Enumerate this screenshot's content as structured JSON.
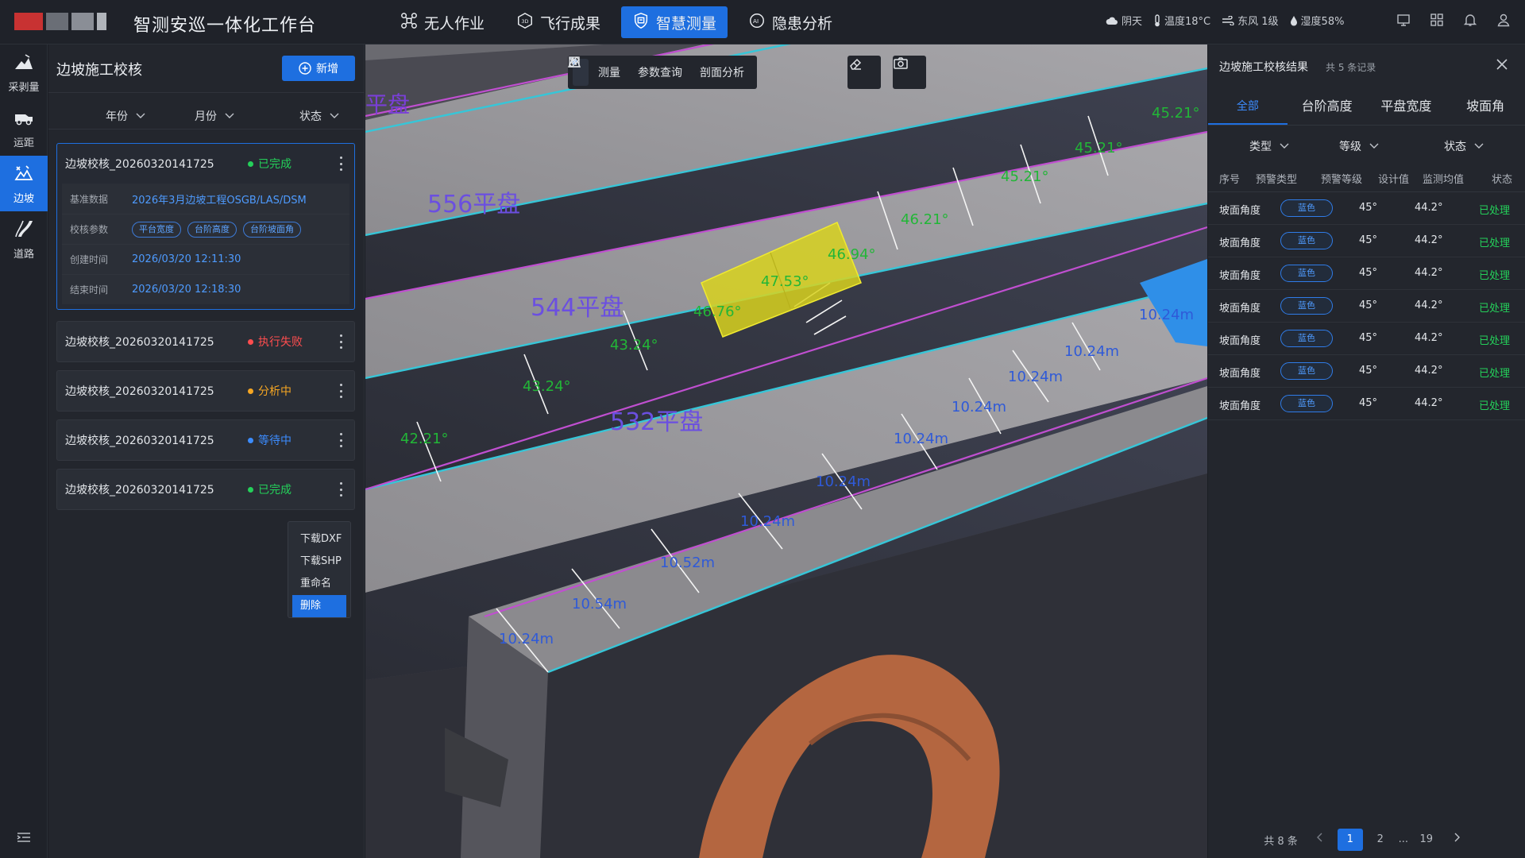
{
  "header": {
    "title": "智测安巡一体化工作台",
    "nav": [
      {
        "label": "无人作业",
        "icon": "drone-icon"
      },
      {
        "label": "飞行成果",
        "icon": "3d-icon"
      },
      {
        "label": "智慧测量",
        "icon": "survey-icon",
        "active": true
      },
      {
        "label": "隐患分析",
        "icon": "ai-icon"
      }
    ],
    "weather": {
      "condition": "阴天",
      "temperature": "温度18°C",
      "wind": "东风 1级",
      "humidity": "湿度58%"
    }
  },
  "rail": {
    "items": [
      {
        "label": "采剥量",
        "icon": "mining-icon"
      },
      {
        "label": "运距",
        "icon": "truck-icon"
      },
      {
        "label": "边坡",
        "icon": "slope-icon",
        "active": true
      },
      {
        "label": "道路",
        "icon": "road-icon"
      }
    ]
  },
  "left_panel": {
    "title": "边坡施工校核",
    "add_label": "新增",
    "filters": {
      "year": "年份",
      "month": "月份",
      "status": "状态"
    },
    "cards": [
      {
        "name": "边坡校核_20260320141725",
        "status": "已完成",
        "status_color": "#24d05a",
        "expanded": true,
        "details": {
          "base_label": "基准数据",
          "base_value": "2026年3月边坡工程OSGB/LAS/DSM",
          "params_label": "校核参数",
          "params": [
            "平台宽度",
            "台阶高度",
            "台阶坡面角"
          ],
          "created_label": "创建时间",
          "created_value": "2026/03/20  12:11:30",
          "ended_label": "结束时间",
          "ended_value": "2026/03/20  12:18:30"
        }
      },
      {
        "name": "边坡校核_20260320141725",
        "status": "执行失败",
        "status_color": "#ff4d4f"
      },
      {
        "name": "边坡校核_20260320141725",
        "status": "分析中",
        "status_color": "#f5a623"
      },
      {
        "name": "边坡校核_20260320141725",
        "status": "等待中",
        "status_color": "#3c8cff"
      },
      {
        "name": "边坡校核_20260320141725",
        "status": "已完成",
        "status_color": "#24d05a"
      }
    ],
    "context_menu": [
      "下载DXF",
      "下载SHP",
      "重命名",
      "删除"
    ]
  },
  "map": {
    "toolbar": {
      "select": "",
      "measure": "测量",
      "query": "参数查询",
      "profile": "剖面分析"
    },
    "platform_labels": [
      "平盘",
      "556平盘",
      "544平盘",
      "532平盘"
    ],
    "angle_labels": [
      "45.21°",
      "45.21°",
      "45.21°",
      "46.21°",
      "46.94°",
      "47.53°",
      "46.76°",
      "43.24°",
      "43.24°",
      "42.21°"
    ],
    "width_labels": [
      "10.24m",
      "10.24m",
      "10.24m",
      "10.24m",
      "10.24m",
      "10.24m",
      "10.24m",
      "10.52m",
      "10.54m",
      "10.24m"
    ]
  },
  "right_panel": {
    "title": "边坡施工校核结果",
    "count": "共 5 条记录",
    "tabs": [
      "全部",
      "台阶高度",
      "平盘宽度",
      "坡面角"
    ],
    "filters": {
      "type": "类型",
      "level": "等级",
      "status": "状态"
    },
    "columns": [
      "序号",
      "预警类型",
      "预警等级",
      "设计值",
      "监测均值",
      "状态"
    ],
    "rows": [
      {
        "type": "坡面角度",
        "level": "蓝色",
        "design": "45°",
        "measured": "44.2°",
        "status": "已处理"
      },
      {
        "type": "坡面角度",
        "level": "蓝色",
        "design": "45°",
        "measured": "44.2°",
        "status": "已处理"
      },
      {
        "type": "坡面角度",
        "level": "蓝色",
        "design": "45°",
        "measured": "44.2°",
        "status": "已处理"
      },
      {
        "type": "坡面角度",
        "level": "蓝色",
        "design": "45°",
        "measured": "44.2°",
        "status": "已处理"
      },
      {
        "type": "坡面角度",
        "level": "蓝色",
        "design": "45°",
        "measured": "44.2°",
        "status": "已处理"
      },
      {
        "type": "坡面角度",
        "level": "蓝色",
        "design": "45°",
        "measured": "44.2°",
        "status": "已处理"
      },
      {
        "type": "坡面角度",
        "level": "蓝色",
        "design": "45°",
        "measured": "44.2°",
        "status": "已处理"
      }
    ],
    "pagination": {
      "total": "共 8 条",
      "pages": [
        "1",
        "2",
        "...",
        "19"
      ],
      "current": "1"
    }
  },
  "colors": {
    "accent": "#1e6fe0",
    "success": "#24d05a",
    "danger": "#ff4d4f",
    "warning": "#f5a623",
    "bench_line_cyan": "#36c6d8",
    "bench_line_magenta": "#c04fd0",
    "highlight_yellow": "#d8d21f"
  }
}
